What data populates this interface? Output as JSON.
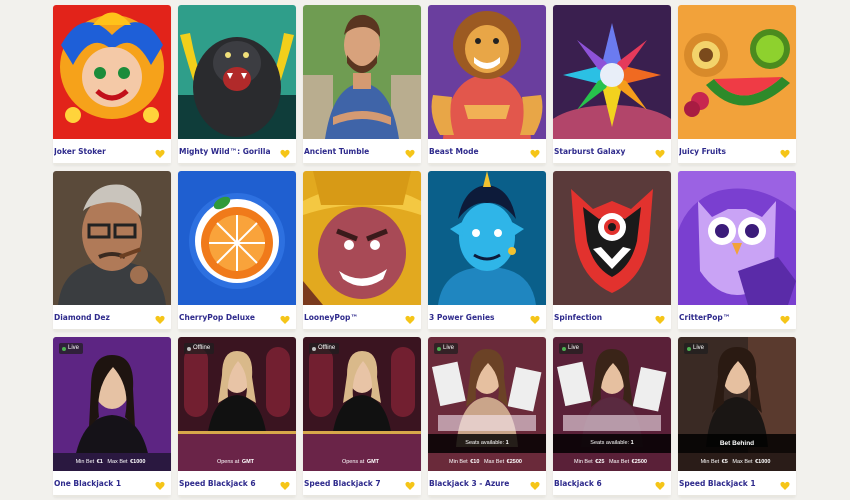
{
  "rows": [
    [
      {
        "title": "Joker Stoker",
        "art": "joker-icon"
      },
      {
        "title": "Mighty Wild™: Gorilla",
        "art": "gorilla-icon"
      },
      {
        "title": "Ancient Tumble",
        "art": "explorer-icon"
      },
      {
        "title": "Beast Mode",
        "art": "lion-icon"
      },
      {
        "title": "Starburst Galaxy",
        "art": "star-gem-icon"
      },
      {
        "title": "Juicy Fruits",
        "art": "fruit-icon"
      }
    ],
    [
      {
        "title": "Diamond Dez",
        "art": "mobster-icon"
      },
      {
        "title": "CherryPop Deluxe",
        "art": "orange-icon"
      },
      {
        "title": "LooneyPop™",
        "art": "cowboy-icon"
      },
      {
        "title": "3 Power Genies",
        "art": "genie-icon"
      },
      {
        "title": "Spinfection",
        "art": "devil-mask-icon"
      },
      {
        "title": "CritterPop™",
        "art": "owl-icon"
      }
    ],
    [
      {
        "title": "One Blackjack 1",
        "status": "Live",
        "min_label": "Min Bet",
        "min": "€1",
        "max_label": "Max Bet",
        "max": "€1000"
      },
      {
        "title": "Speed Blackjack 6",
        "status": "Offline",
        "open_label": "Opens at",
        "open": "GMT"
      },
      {
        "title": "Speed Blackjack 7",
        "status": "Offline",
        "open_label": "Opens at",
        "open": "GMT"
      },
      {
        "title": "Blackjack 3 - Azure",
        "status": "Live",
        "seats_label": "Seats available:",
        "seats": "1",
        "min_label": "Min Bet",
        "min": "€10",
        "max_label": "Max Bet",
        "max": "€2500"
      },
      {
        "title": "Blackjack 6",
        "status": "Live",
        "seats_label": "Seats available:",
        "seats": "1",
        "min_label": "Min Bet",
        "min": "€25",
        "max_label": "Max Bet",
        "max": "€2500"
      },
      {
        "title": "Speed Blackjack 1",
        "status": "Live",
        "overlay": "Bet Behind",
        "min_label": "Min Bet",
        "min": "€5",
        "max_label": "Max Bet",
        "max": "€1000"
      }
    ]
  ],
  "colors": {
    "title": "#2e2a8c",
    "heart": "#f5c518",
    "background": "#f2f1ed"
  }
}
